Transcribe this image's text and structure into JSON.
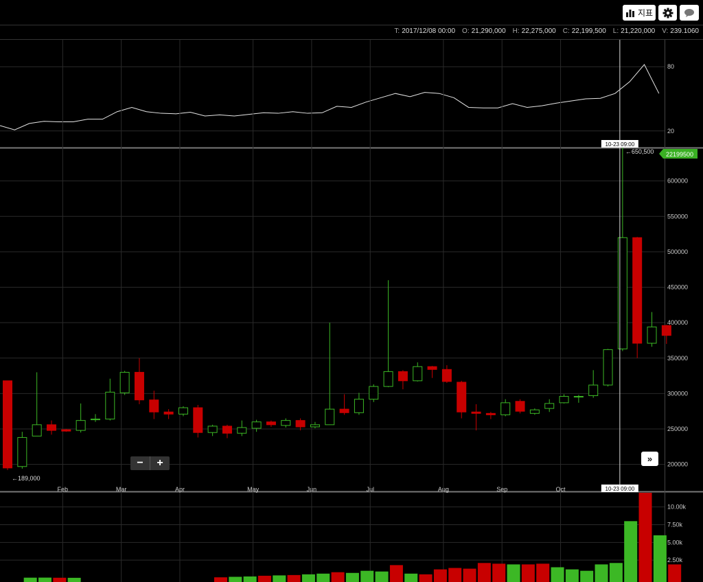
{
  "toolbar": {
    "indicator_label": "지표",
    "settings_icon": "gear-icon",
    "chat_icon": "speech-bubble-icon",
    "chart_icon": "bar-chart-icon"
  },
  "ohlc": [
    {
      "key": "T:",
      "value": "2017/12/08 00:00"
    },
    {
      "key": "O:",
      "value": "21,290,000"
    },
    {
      "key": "H:",
      "value": "22,275,000"
    },
    {
      "key": "C:",
      "value": "22,199,500"
    },
    {
      "key": "L:",
      "value": "21,220,000"
    },
    {
      "key": "V:",
      "value": "239.1060"
    }
  ],
  "controls": {
    "zoom_out": "−",
    "zoom_in": "+",
    "next": "»"
  },
  "colors": {
    "up": "#3cb825",
    "down": "#c80000",
    "grid": "#2a2a2a",
    "price_tag": "#3ab023"
  },
  "chart_data": [
    {
      "type": "line",
      "ylim": [
        0,
        100
      ],
      "yticks": [
        20,
        80
      ],
      "x": [
        0,
        1,
        2,
        3,
        4,
        5,
        6,
        7,
        8,
        9,
        10,
        11,
        12,
        13,
        14,
        15,
        16,
        17,
        18,
        19,
        20,
        21,
        22,
        23,
        24,
        25,
        26,
        27,
        28,
        29,
        30,
        31,
        32,
        33,
        34,
        35,
        36,
        37,
        38,
        39,
        40,
        41,
        42,
        43,
        44,
        45
      ],
      "values": [
        25,
        21,
        27,
        29,
        28.5,
        28.5,
        31,
        31,
        38,
        42,
        38,
        36.5,
        36,
        37.5,
        34,
        35,
        34,
        35.5,
        37,
        36.5,
        38,
        36.5,
        37,
        43,
        42,
        47,
        51,
        55,
        52,
        56,
        55,
        51,
        42,
        41.5,
        41.5,
        45.5,
        42,
        43.5,
        46,
        48,
        50,
        50.5,
        55,
        66,
        82,
        55
      ]
    },
    {
      "type": "candlestick",
      "ylim": [
        190000,
        650000
      ],
      "yticks": [
        200000,
        250000,
        300000,
        350000,
        400000,
        450000,
        500000,
        550000,
        600000
      ],
      "x_ticks": [
        {
          "label": "Feb",
          "i": 4
        },
        {
          "label": "Mar",
          "i": 8
        },
        {
          "label": "Apr",
          "i": 12
        },
        {
          "label": "May",
          "i": 17
        },
        {
          "label": "Jun",
          "i": 21
        },
        {
          "label": "Jul",
          "i": 25
        },
        {
          "label": "Aug",
          "i": 30
        },
        {
          "label": "Sep",
          "i": 34
        },
        {
          "label": "Oct",
          "i": 38
        }
      ],
      "candles": [
        [
          318000,
          195000,
          318000,
          192000
        ],
        [
          197000,
          238000,
          246000,
          194000
        ],
        [
          240000,
          256000,
          330000,
          240000
        ],
        [
          256000,
          248000,
          262000,
          242000
        ],
        [
          249000,
          247000,
          250000,
          246000
        ],
        [
          248000,
          262000,
          286000,
          245000
        ],
        [
          263000,
          264000,
          271000,
          260000
        ],
        [
          264000,
          302000,
          321000,
          262000
        ],
        [
          301000,
          330000,
          332000,
          298000
        ],
        [
          330000,
          291000,
          350000,
          285000
        ],
        [
          291000,
          274000,
          304000,
          264000
        ],
        [
          274000,
          271000,
          278000,
          264000
        ],
        [
          271000,
          280000,
          282000,
          268000
        ],
        [
          280000,
          245000,
          284000,
          238000
        ],
        [
          245000,
          254000,
          256000,
          240000
        ],
        [
          254000,
          244000,
          256000,
          237000
        ],
        [
          244000,
          252000,
          262000,
          240000
        ],
        [
          251000,
          260000,
          263000,
          246000
        ],
        [
          260000,
          256000,
          262000,
          253000
        ],
        [
          255000,
          262000,
          265000,
          252000
        ],
        [
          262000,
          253000,
          265000,
          248000
        ],
        [
          253000,
          256000,
          260000,
          251000
        ],
        [
          256000,
          278000,
          400000,
          256000
        ],
        [
          278000,
          273000,
          299000,
          270000
        ],
        [
          273000,
          292000,
          301000,
          270000
        ],
        [
          292000,
          310000,
          313000,
          288000
        ],
        [
          310000,
          331000,
          460000,
          309000
        ],
        [
          331000,
          318000,
          333000,
          306000
        ],
        [
          318000,
          338000,
          344000,
          317000
        ],
        [
          338000,
          334000,
          339000,
          322000
        ],
        [
          334000,
          317000,
          340000,
          315000
        ],
        [
          316000,
          274000,
          318000,
          265000
        ],
        [
          274000,
          272000,
          285000,
          248000
        ],
        [
          272000,
          270000,
          274000,
          264000
        ],
        [
          270000,
          287000,
          292000,
          268000
        ],
        [
          289000,
          275000,
          292000,
          272000
        ],
        [
          272000,
          277000,
          279000,
          270000
        ],
        [
          279000,
          286000,
          292000,
          274000
        ],
        [
          287000,
          296000,
          299000,
          286000
        ],
        [
          295000,
          296000,
          298000,
          287000
        ],
        [
          297000,
          312000,
          333000,
          294000
        ],
        [
          312000,
          362000,
          363000,
          310000
        ],
        [
          363000,
          520000,
          650500,
          360000
        ],
        [
          520000,
          371000,
          521000,
          350000
        ],
        [
          371000,
          394000,
          415000,
          366000
        ],
        [
          396000,
          382000,
          397000,
          370000
        ]
      ],
      "annotations": [
        {
          "label": "←650,500",
          "i": 42
        },
        {
          "label": "←189,000",
          "i": 0
        }
      ],
      "last_price_label": "22199500",
      "crosshair_time_label": "10-23 09:00"
    },
    {
      "type": "bar",
      "ylim": [
        0,
        12000
      ],
      "yticks": [
        {
          "v": 2500,
          "label": "2.50k"
        },
        {
          "v": 5000,
          "label": "5.00k"
        },
        {
          "v": 7500,
          "label": "7.50k"
        },
        {
          "v": 10000,
          "label": "10.00k"
        }
      ],
      "values": [
        0,
        0,
        30,
        40,
        20,
        10,
        0,
        0,
        0,
        0,
        0,
        0,
        0,
        0,
        0,
        80,
        150,
        200,
        300,
        350,
        400,
        500,
        600,
        800,
        700,
        1000,
        900,
        1800,
        600,
        500,
        1200,
        1400,
        1300,
        2100,
        2000,
        1900,
        1900,
        2000,
        1500,
        1200,
        1000,
        1900,
        2100,
        8000,
        12000,
        6000,
        1900
      ],
      "up": [
        true,
        false,
        true,
        true,
        false,
        true,
        true,
        true,
        true,
        false,
        false,
        false,
        true,
        false,
        true,
        false,
        true,
        true,
        false,
        true,
        false,
        true,
        true,
        false,
        true,
        true,
        true,
        false,
        true,
        false,
        false,
        false,
        false,
        false,
        false,
        true,
        false,
        false,
        true,
        true,
        true,
        true,
        true,
        true,
        false,
        true,
        false
      ]
    }
  ]
}
